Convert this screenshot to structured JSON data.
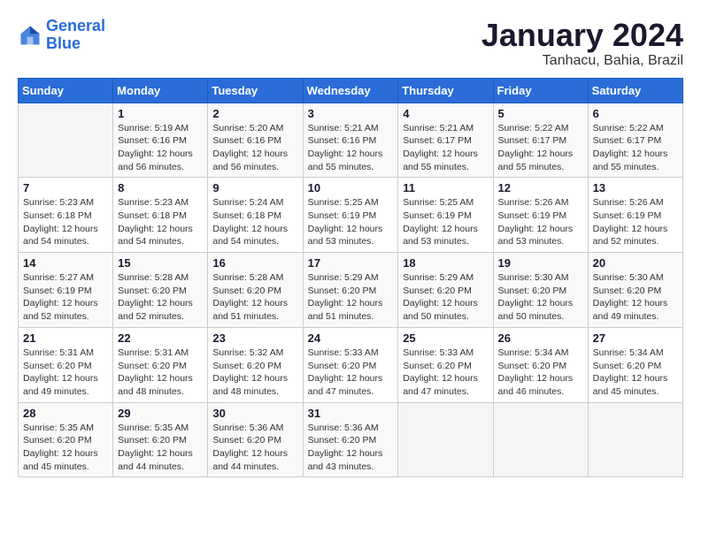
{
  "header": {
    "logo_line1": "General",
    "logo_line2": "Blue",
    "month": "January 2024",
    "location": "Tanhacu, Bahia, Brazil"
  },
  "weekdays": [
    "Sunday",
    "Monday",
    "Tuesday",
    "Wednesday",
    "Thursday",
    "Friday",
    "Saturday"
  ],
  "weeks": [
    [
      {
        "day": "",
        "sunrise": "",
        "sunset": "",
        "daylight": ""
      },
      {
        "day": "1",
        "sunrise": "Sunrise: 5:19 AM",
        "sunset": "Sunset: 6:16 PM",
        "daylight": "Daylight: 12 hours and 56 minutes."
      },
      {
        "day": "2",
        "sunrise": "Sunrise: 5:20 AM",
        "sunset": "Sunset: 6:16 PM",
        "daylight": "Daylight: 12 hours and 56 minutes."
      },
      {
        "day": "3",
        "sunrise": "Sunrise: 5:21 AM",
        "sunset": "Sunset: 6:16 PM",
        "daylight": "Daylight: 12 hours and 55 minutes."
      },
      {
        "day": "4",
        "sunrise": "Sunrise: 5:21 AM",
        "sunset": "Sunset: 6:17 PM",
        "daylight": "Daylight: 12 hours and 55 minutes."
      },
      {
        "day": "5",
        "sunrise": "Sunrise: 5:22 AM",
        "sunset": "Sunset: 6:17 PM",
        "daylight": "Daylight: 12 hours and 55 minutes."
      },
      {
        "day": "6",
        "sunrise": "Sunrise: 5:22 AM",
        "sunset": "Sunset: 6:17 PM",
        "daylight": "Daylight: 12 hours and 55 minutes."
      }
    ],
    [
      {
        "day": "7",
        "sunrise": "Sunrise: 5:23 AM",
        "sunset": "Sunset: 6:18 PM",
        "daylight": "Daylight: 12 hours and 54 minutes."
      },
      {
        "day": "8",
        "sunrise": "Sunrise: 5:23 AM",
        "sunset": "Sunset: 6:18 PM",
        "daylight": "Daylight: 12 hours and 54 minutes."
      },
      {
        "day": "9",
        "sunrise": "Sunrise: 5:24 AM",
        "sunset": "Sunset: 6:18 PM",
        "daylight": "Daylight: 12 hours and 54 minutes."
      },
      {
        "day": "10",
        "sunrise": "Sunrise: 5:25 AM",
        "sunset": "Sunset: 6:19 PM",
        "daylight": "Daylight: 12 hours and 53 minutes."
      },
      {
        "day": "11",
        "sunrise": "Sunrise: 5:25 AM",
        "sunset": "Sunset: 6:19 PM",
        "daylight": "Daylight: 12 hours and 53 minutes."
      },
      {
        "day": "12",
        "sunrise": "Sunrise: 5:26 AM",
        "sunset": "Sunset: 6:19 PM",
        "daylight": "Daylight: 12 hours and 53 minutes."
      },
      {
        "day": "13",
        "sunrise": "Sunrise: 5:26 AM",
        "sunset": "Sunset: 6:19 PM",
        "daylight": "Daylight: 12 hours and 52 minutes."
      }
    ],
    [
      {
        "day": "14",
        "sunrise": "Sunrise: 5:27 AM",
        "sunset": "Sunset: 6:19 PM",
        "daylight": "Daylight: 12 hours and 52 minutes."
      },
      {
        "day": "15",
        "sunrise": "Sunrise: 5:28 AM",
        "sunset": "Sunset: 6:20 PM",
        "daylight": "Daylight: 12 hours and 52 minutes."
      },
      {
        "day": "16",
        "sunrise": "Sunrise: 5:28 AM",
        "sunset": "Sunset: 6:20 PM",
        "daylight": "Daylight: 12 hours and 51 minutes."
      },
      {
        "day": "17",
        "sunrise": "Sunrise: 5:29 AM",
        "sunset": "Sunset: 6:20 PM",
        "daylight": "Daylight: 12 hours and 51 minutes."
      },
      {
        "day": "18",
        "sunrise": "Sunrise: 5:29 AM",
        "sunset": "Sunset: 6:20 PM",
        "daylight": "Daylight: 12 hours and 50 minutes."
      },
      {
        "day": "19",
        "sunrise": "Sunrise: 5:30 AM",
        "sunset": "Sunset: 6:20 PM",
        "daylight": "Daylight: 12 hours and 50 minutes."
      },
      {
        "day": "20",
        "sunrise": "Sunrise: 5:30 AM",
        "sunset": "Sunset: 6:20 PM",
        "daylight": "Daylight: 12 hours and 49 minutes."
      }
    ],
    [
      {
        "day": "21",
        "sunrise": "Sunrise: 5:31 AM",
        "sunset": "Sunset: 6:20 PM",
        "daylight": "Daylight: 12 hours and 49 minutes."
      },
      {
        "day": "22",
        "sunrise": "Sunrise: 5:31 AM",
        "sunset": "Sunset: 6:20 PM",
        "daylight": "Daylight: 12 hours and 48 minutes."
      },
      {
        "day": "23",
        "sunrise": "Sunrise: 5:32 AM",
        "sunset": "Sunset: 6:20 PM",
        "daylight": "Daylight: 12 hours and 48 minutes."
      },
      {
        "day": "24",
        "sunrise": "Sunrise: 5:33 AM",
        "sunset": "Sunset: 6:20 PM",
        "daylight": "Daylight: 12 hours and 47 minutes."
      },
      {
        "day": "25",
        "sunrise": "Sunrise: 5:33 AM",
        "sunset": "Sunset: 6:20 PM",
        "daylight": "Daylight: 12 hours and 47 minutes."
      },
      {
        "day": "26",
        "sunrise": "Sunrise: 5:34 AM",
        "sunset": "Sunset: 6:20 PM",
        "daylight": "Daylight: 12 hours and 46 minutes."
      },
      {
        "day": "27",
        "sunrise": "Sunrise: 5:34 AM",
        "sunset": "Sunset: 6:20 PM",
        "daylight": "Daylight: 12 hours and 45 minutes."
      }
    ],
    [
      {
        "day": "28",
        "sunrise": "Sunrise: 5:35 AM",
        "sunset": "Sunset: 6:20 PM",
        "daylight": "Daylight: 12 hours and 45 minutes."
      },
      {
        "day": "29",
        "sunrise": "Sunrise: 5:35 AM",
        "sunset": "Sunset: 6:20 PM",
        "daylight": "Daylight: 12 hours and 44 minutes."
      },
      {
        "day": "30",
        "sunrise": "Sunrise: 5:36 AM",
        "sunset": "Sunset: 6:20 PM",
        "daylight": "Daylight: 12 hours and 44 minutes."
      },
      {
        "day": "31",
        "sunrise": "Sunrise: 5:36 AM",
        "sunset": "Sunset: 6:20 PM",
        "daylight": "Daylight: 12 hours and 43 minutes."
      },
      {
        "day": "",
        "sunrise": "",
        "sunset": "",
        "daylight": ""
      },
      {
        "day": "",
        "sunrise": "",
        "sunset": "",
        "daylight": ""
      },
      {
        "day": "",
        "sunrise": "",
        "sunset": "",
        "daylight": ""
      }
    ]
  ]
}
